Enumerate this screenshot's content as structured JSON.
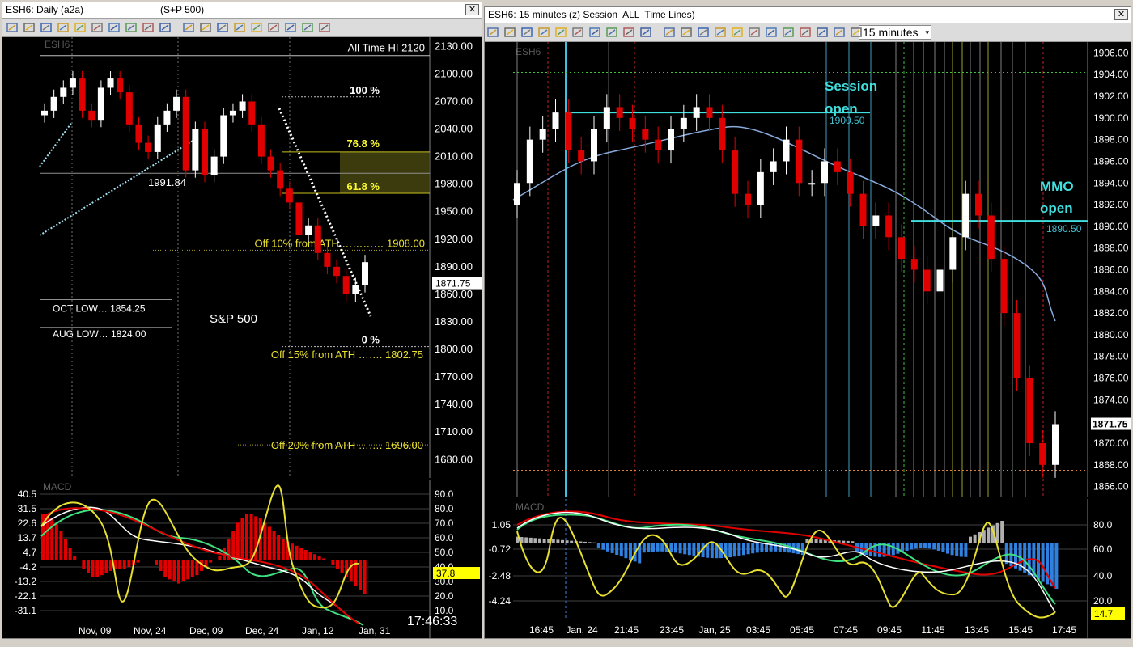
{
  "left_window": {
    "title": "ESH6: Daily (a2a)",
    "title_symbol": "(S+P 500)",
    "close_label": "✕",
    "symbol_watermark": "ESH6",
    "toolbar_icons": [
      "cursor-icon",
      "bar-style-icon",
      "save-icon",
      "drawing-tools-icon",
      "star-icon",
      "format-icon",
      "table-icon",
      "calendar-icon",
      "insert-icon",
      "grid-icon",
      "cross-icon",
      "arrow-right-icon",
      "wave-icon",
      "ellipse-icon",
      "rectangle-icon",
      "line-icon",
      "trendline-icon",
      "zoom-in-icon",
      "zoom-out-icon"
    ],
    "price_axis": [
      "2130.00",
      "2100.00",
      "2070.00",
      "2040.00",
      "2010.00",
      "1980.00",
      "1950.00",
      "1920.00",
      "1890.00",
      "1860.00",
      "1830.00",
      "1800.00",
      "1770.00",
      "1740.00",
      "1710.00",
      "1680.00"
    ],
    "last_price": "1871.75",
    "annotations": {
      "ath": "All Time HI 2120",
      "fib_100": "100 %",
      "fib_768": "76.8 %",
      "fib_618": "61.8 %",
      "fib_0": "0 %",
      "off10": "Off 10% from ATH ………… 1908.00",
      "off15": "Off 15% from ATH ……. 1802.75",
      "off20": "Off 20% from ATH ……. 1696.00",
      "low_1991": "1991.84",
      "oct_low": "OCT LOW…    1854.25",
      "aug_low": "AUG LOW…    1824.00",
      "sp500": "S&P 500"
    },
    "macd": {
      "label": "MACD",
      "left_axis": [
        "40.5",
        "31.5",
        "22.6",
        "13.7",
        "4.7",
        "-4.2",
        "-13.2",
        "-22.1",
        "-31.1"
      ],
      "right_axis": [
        "90.0",
        "80.0",
        "70.0",
        "60.0",
        "50.0",
        "40.0",
        "30.0",
        "20.0",
        "10.0"
      ],
      "stoch_value": "37.8"
    },
    "date_axis": [
      "Nov, 09",
      "Nov, 24",
      "Dec, 09",
      "Dec, 24",
      "Jan, 12",
      "Jan, 31"
    ],
    "clock": "17:46:33"
  },
  "right_window": {
    "title": "ESH6: 15 minutes (z) Session  ALL  Time Lines)",
    "close_label": "✕",
    "timeframe": "15 minutes",
    "symbol_watermark": "ESH6",
    "toolbar_icons": [
      "pin-icon",
      "cursor-icon",
      "bar-style-icon",
      "save-icon",
      "drawing-tools-icon",
      "star-icon",
      "format-icon",
      "table-icon",
      "calendar-icon",
      "insert-icon",
      "grid-icon",
      "ellipse-icon",
      "arrow-right-icon",
      "wave-icon",
      "ellipse-icon",
      "rectangle-icon",
      "line-icon",
      "trendline-icon",
      "zoom-in-icon",
      "zoom-out-icon",
      "pointer-icon",
      "magnifier-icon"
    ],
    "price_axis": [
      "1906.00",
      "1904.00",
      "1902.00",
      "1900.00",
      "1898.00",
      "1896.00",
      "1894.00",
      "1892.00",
      "1890.00",
      "1888.00",
      "1886.00",
      "1884.00",
      "1882.00",
      "1880.00",
      "1878.00",
      "1876.00",
      "1874.00",
      "1872.00",
      "1870.00",
      "1868.00",
      "1866.00"
    ],
    "last_price": "1871.75",
    "annotations": {
      "session_open_1": "Session",
      "session_open_2": "open",
      "session_level": "1900.50",
      "mmo_open_1": "MMO",
      "mmo_open_2": "open",
      "mmo_level": "1890.50"
    },
    "macd": {
      "label": "MACD",
      "left_axis": [
        "1.05",
        "-0.72",
        "-2.48",
        "-4.24"
      ],
      "right_axis": [
        "80.0",
        "60.0",
        "40.0",
        "20.0"
      ],
      "stoch_value": "14.7"
    },
    "time_axis": [
      "16:45",
      "Jan, 24",
      "21:45",
      "23:45",
      "Jan, 25",
      "03:45",
      "05:45",
      "07:45",
      "09:45",
      "11:45",
      "13:45",
      "15:45",
      "17:45"
    ]
  },
  "chart_data": [
    {
      "type": "candlestick",
      "title": "ESH6: Daily (a2a)",
      "ylim": [
        1660,
        2140
      ],
      "levels": {
        "all_time_high": 2120,
        "off_10pct": 1908.0,
        "off_15pct": 1802.75,
        "off_20pct": 1696.0,
        "oct_low": 1854.25,
        "aug_low": 1824.0,
        "swing_low": 1991.84,
        "fib_100": 2075,
        "fib_0": 1803
      },
      "x": [
        "Nov, 09",
        "Nov, 24",
        "Dec, 09",
        "Dec, 24",
        "Jan, 12",
        "Jan, 31"
      ],
      "close": [
        2060,
        2075,
        2085,
        2095,
        2060,
        2050,
        2085,
        2095,
        2080,
        2045,
        2025,
        2015,
        2045,
        2060,
        2075,
        1995,
        2040,
        1990,
        2010,
        2055,
        2060,
        2070,
        2045,
        2010,
        1995,
        1975,
        1960,
        1925,
        1935,
        1905,
        1890,
        1880,
        1860,
        1870,
        1895
      ],
      "last": 1871.75
    },
    {
      "type": "candlestick",
      "title": "ESH6: 15 minutes (z) Session  ALL  Time Lines)",
      "ylim": [
        1865,
        1907
      ],
      "levels": {
        "session_open": 1900.5,
        "mmo_open": 1890.5,
        "upper_dotted": 1904.2,
        "lower_dotted": 1867.5
      },
      "x": [
        "16:45",
        "Jan, 24",
        "21:45",
        "23:45",
        "Jan, 25",
        "03:45",
        "05:45",
        "07:45",
        "09:45",
        "11:45",
        "13:45",
        "15:45",
        "17:45"
      ],
      "close": [
        1894,
        1898,
        1899,
        1900.5,
        1897,
        1896,
        1899,
        1901,
        1900,
        1899,
        1898,
        1897,
        1899,
        1900,
        1901,
        1900,
        1897,
        1893,
        1892,
        1895,
        1896,
        1898,
        1894,
        1894,
        1896,
        1895,
        1893,
        1890,
        1891,
        1889,
        1887,
        1886,
        1884,
        1886,
        1889,
        1893,
        1891,
        1887,
        1882,
        1876,
        1870,
        1868,
        1871.75
      ],
      "last": 1871.75
    }
  ]
}
